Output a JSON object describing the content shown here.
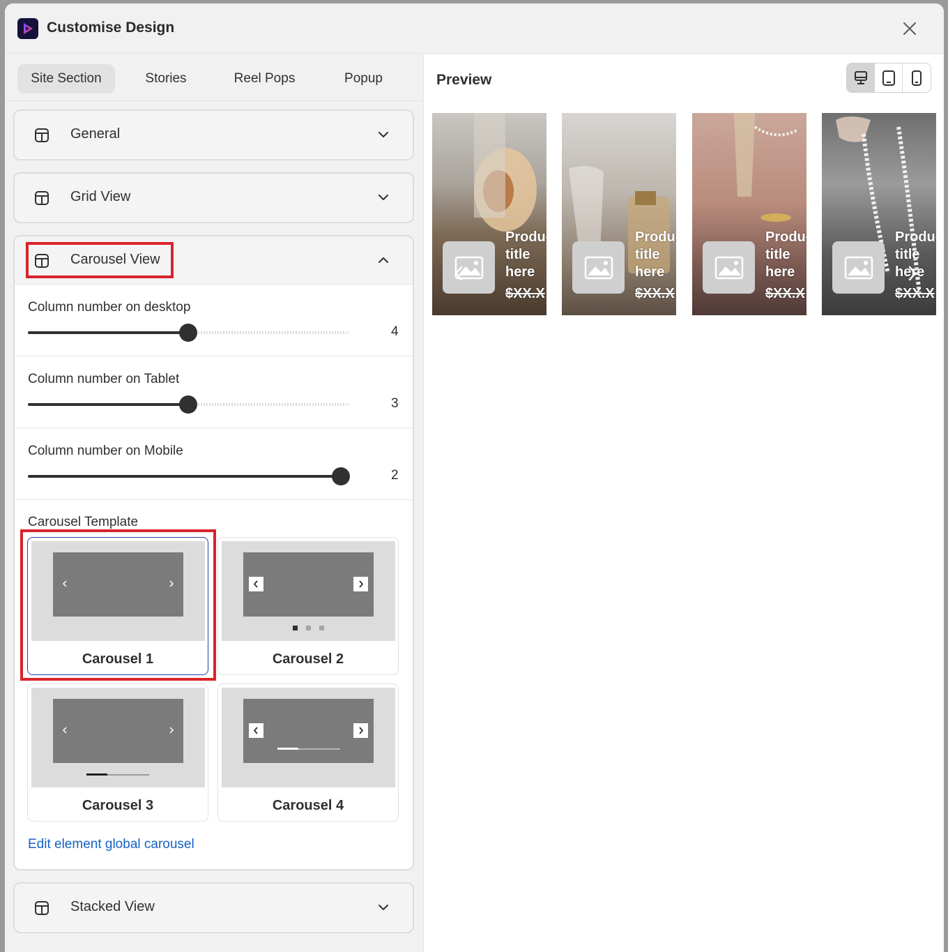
{
  "header": {
    "title": "Customise Design"
  },
  "tabs": [
    {
      "label": "Site Section",
      "active": true
    },
    {
      "label": "Stories",
      "active": false
    },
    {
      "label": "Reel Pops",
      "active": false
    },
    {
      "label": "Popup",
      "active": false
    }
  ],
  "panels": {
    "general": {
      "title": "General"
    },
    "grid_view": {
      "title": "Grid View"
    },
    "carousel_view": {
      "title": "Carousel View",
      "sliders": [
        {
          "label": "Column number on desktop",
          "value": "4",
          "fraction": 0.5
        },
        {
          "label": "Column number on Tablet",
          "value": "3",
          "fraction": 0.5
        },
        {
          "label": "Column number on Mobile",
          "value": "2",
          "fraction": 1.0
        }
      ],
      "template_heading": "Carousel Template",
      "templates": [
        {
          "label": "Carousel 1",
          "selected": true
        },
        {
          "label": "Carousel 2",
          "selected": false
        },
        {
          "label": "Carousel 3",
          "selected": false
        },
        {
          "label": "Carousel 4",
          "selected": false
        }
      ],
      "edit_link": "Edit element global carousel"
    },
    "stacked_view": {
      "title": "Stacked View"
    }
  },
  "preview": {
    "title": "Preview",
    "device_active": "desktop",
    "cards": [
      {
        "title_line1": "Produc",
        "title_line2": "title",
        "title_line3": "here",
        "price": "$XX.X"
      },
      {
        "title_line1": "Produc",
        "title_line2": "title",
        "title_line3": "here",
        "price": "$XX.X"
      },
      {
        "title_line1": "Produc",
        "title_line2": "title",
        "title_line3": "here",
        "price": "$XX.X"
      },
      {
        "title_line1": "Produc",
        "title_line2": "title",
        "title_line3": "here",
        "price": "$XX.X"
      }
    ]
  },
  "colors": {
    "highlight": "#d9232a",
    "link": "#1462c4",
    "selected_border": "#2a3ca8"
  }
}
